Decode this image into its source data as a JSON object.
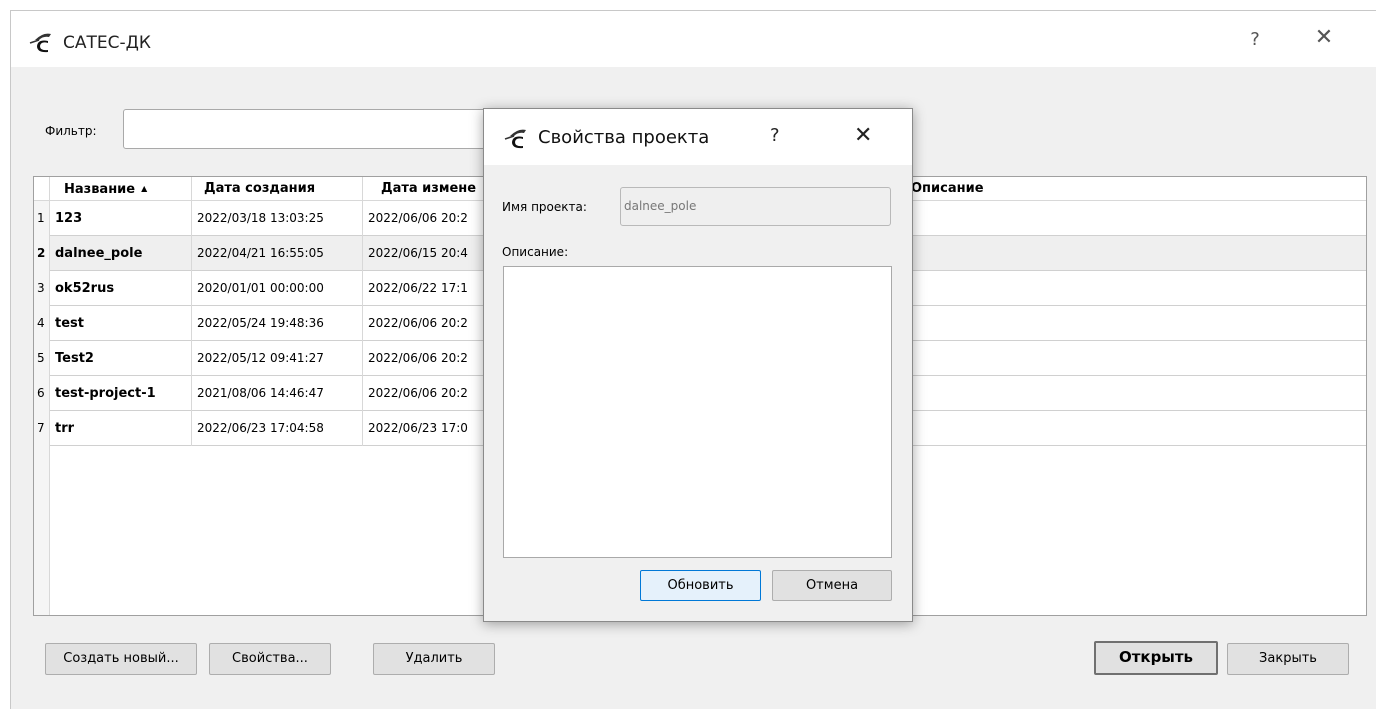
{
  "window": {
    "title": "САТЕС-ДК",
    "help_glyph": "?",
    "close_glyph": "✕"
  },
  "filter": {
    "label": "Фильтр:",
    "value": ""
  },
  "table": {
    "columns": [
      "Название",
      "Дата создания",
      "Дата измене",
      "Описание"
    ],
    "rows": [
      {
        "num": "1",
        "name": "123",
        "created": "2022/03/18 13:03:25",
        "modified": "2022/06/06 20:2",
        "description": ""
      },
      {
        "num": "2",
        "name": "dalnee_pole",
        "created": "2022/04/21 16:55:05",
        "modified": "2022/06/15 20:4",
        "description": ""
      },
      {
        "num": "3",
        "name": "ok52rus",
        "created": "2020/01/01 00:00:00",
        "modified": "2022/06/22 17:1",
        "description": ""
      },
      {
        "num": "4",
        "name": "test",
        "created": "2022/05/24 19:48:36",
        "modified": "2022/06/06 20:2",
        "description": ""
      },
      {
        "num": "5",
        "name": "Test2",
        "created": "2022/05/12 09:41:27",
        "modified": "2022/06/06 20:2",
        "description": ""
      },
      {
        "num": "6",
        "name": "test-project-1",
        "created": "2021/08/06 14:46:47",
        "modified": "2022/06/06 20:2",
        "description": ""
      },
      {
        "num": "7",
        "name": "trr",
        "created": "2022/06/23 17:04:58",
        "modified": "2022/06/23 17:0",
        "description": ""
      }
    ]
  },
  "buttons": {
    "create": "Создать новый...",
    "properties": "Свойства...",
    "delete": "Удалить",
    "open": "Открыть",
    "close": "Закрыть"
  },
  "dialog": {
    "title": "Свойства проекта",
    "help_glyph": "?",
    "close_glyph": "✕",
    "name_label": "Имя проекта:",
    "name_value": "dalnee_pole",
    "description_label": "Описание:",
    "description_value": "",
    "update_button": "Обновить",
    "cancel_button": "Отмена"
  },
  "colors": {
    "window_bg": "#f0f0f0",
    "titlebar_bg": "#ffffff",
    "focus_accent": "#0078d7"
  }
}
